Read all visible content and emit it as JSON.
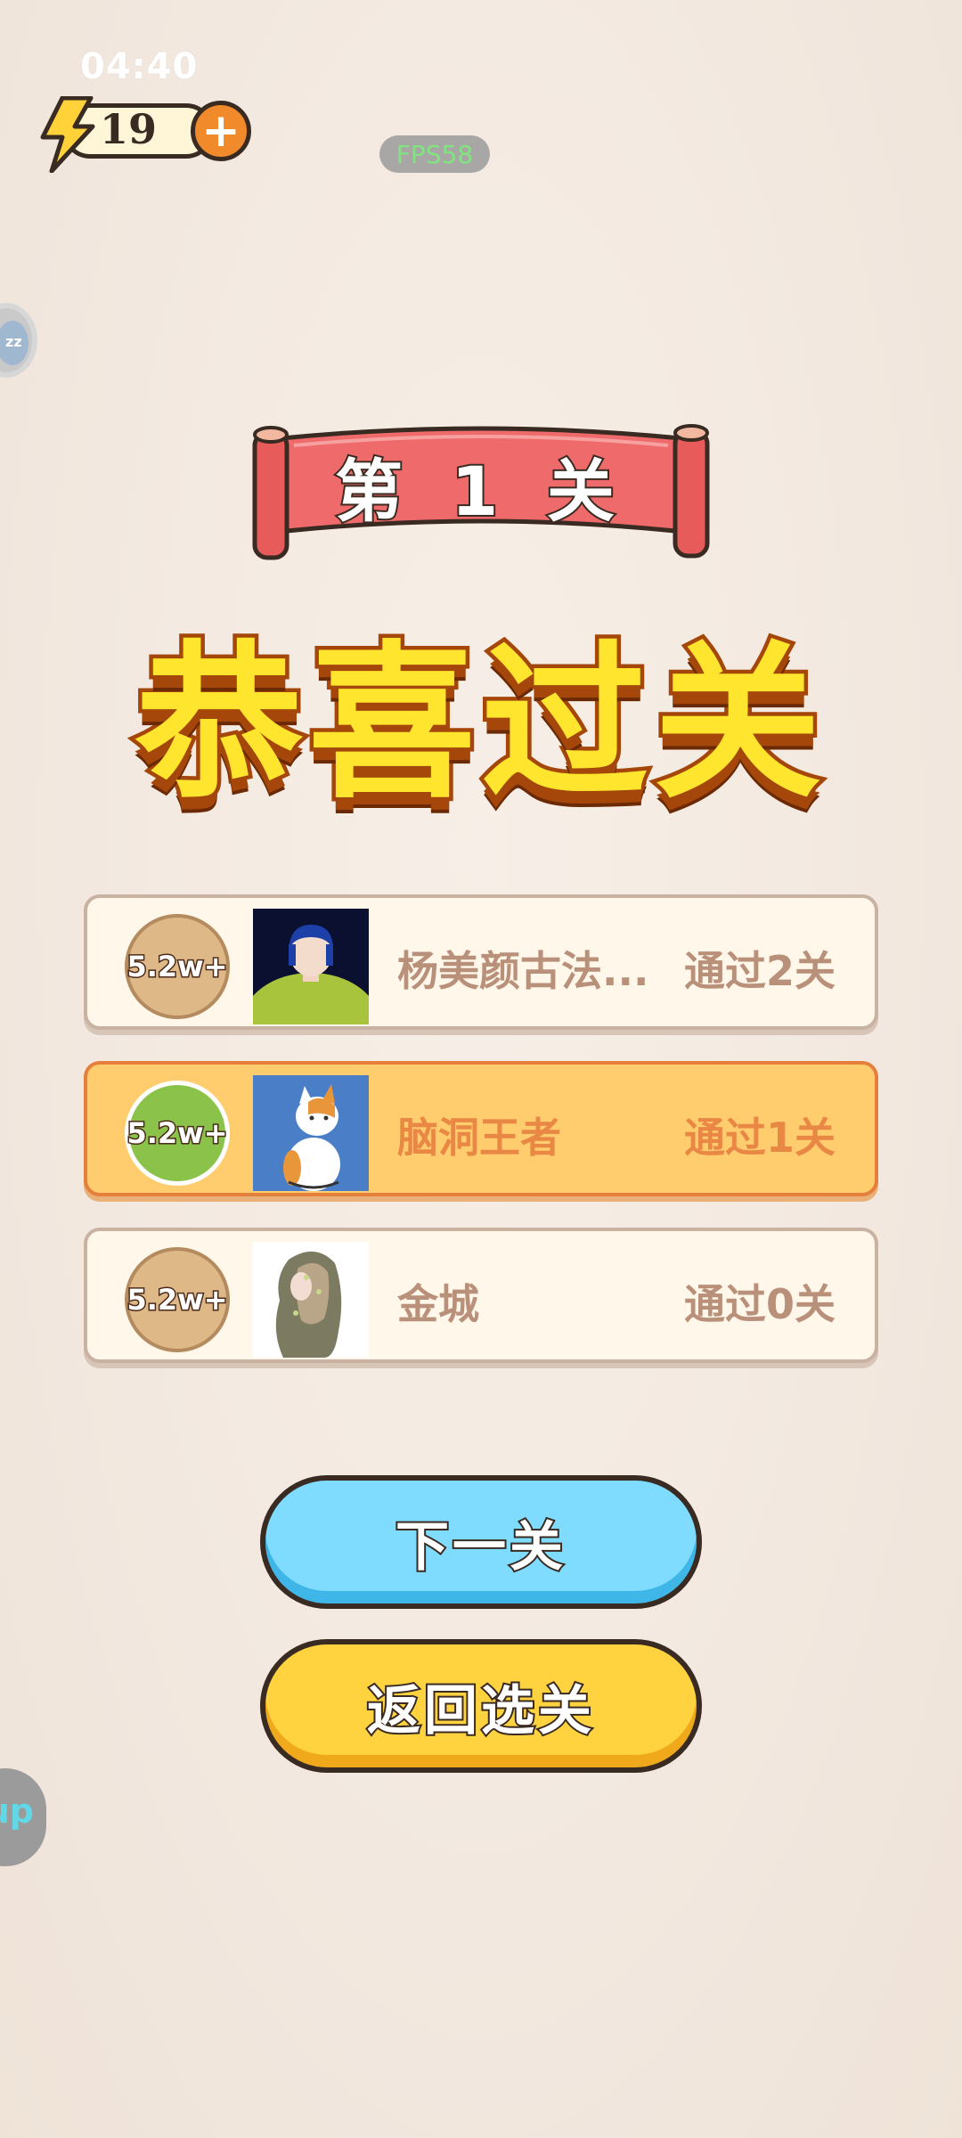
{
  "status_bar": {
    "time": "04:40"
  },
  "hud": {
    "energy": "19",
    "fps": "FPS58"
  },
  "floating": {
    "top_bubble_text": "zz",
    "bottom_bubble_text": "up"
  },
  "banner": {
    "level_text": "第 1 关"
  },
  "result": {
    "title": "恭喜过关"
  },
  "leaderboard": [
    {
      "score_badge": "5.2w+",
      "name": "杨美颜古法...",
      "passed": "通过2关",
      "highlight": false
    },
    {
      "score_badge": "5.2w+",
      "name": "脑洞王者",
      "passed": "通过1关",
      "highlight": true
    },
    {
      "score_badge": "5.2w+",
      "name": "金城",
      "passed": "通过0关",
      "highlight": false
    }
  ],
  "buttons": {
    "next": "下一关",
    "back": "返回选关"
  },
  "colors": {
    "accent_red": "#ef6b6b",
    "title_yellow": "#ffe52e",
    "button_blue": "#7fdcff",
    "button_yellow": "#ffd23f"
  },
  "icons": [
    "lightning-icon",
    "plus-icon"
  ]
}
